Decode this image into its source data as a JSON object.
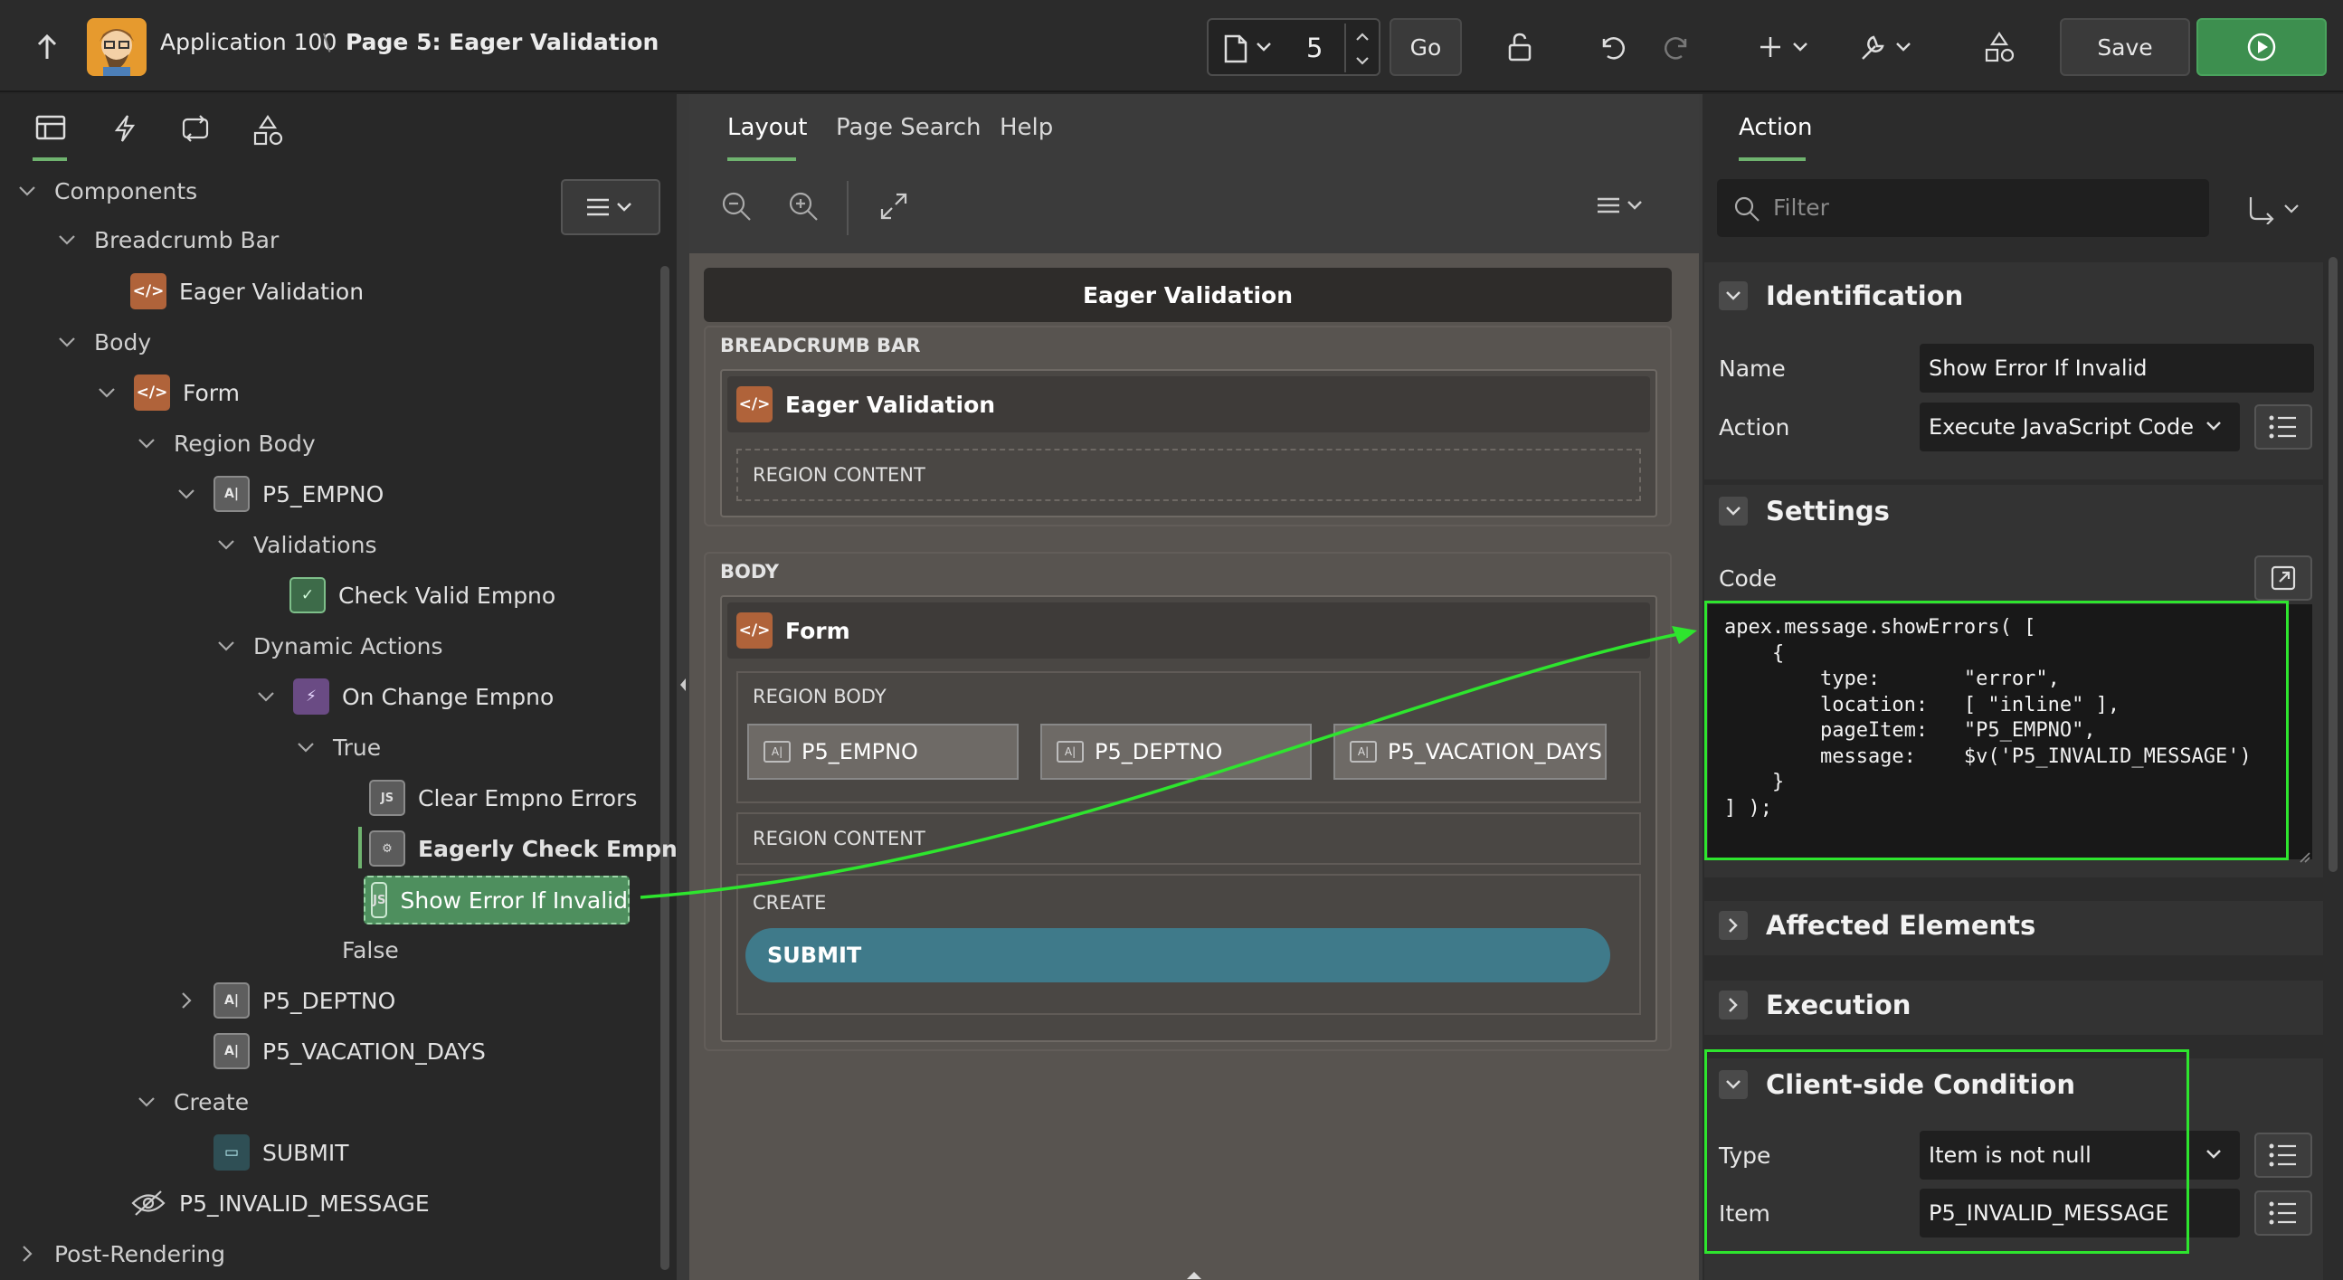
{
  "header": {
    "app_title": "Application 100",
    "separator": "\\",
    "page_title": "Page 5: Eager Validation",
    "page_number": "5",
    "go_label": "Go",
    "save_label": "Save"
  },
  "left_tabs": [
    "rendering-icon",
    "dynamic-actions-icon",
    "processing-icon",
    "shared-components-icon"
  ],
  "tree": {
    "components": "Components",
    "breadcrumb_bar": "Breadcrumb Bar",
    "eager_validation": "Eager Validation",
    "body": "Body",
    "form": "Form",
    "region_body": "Region Body",
    "p5_empno": "P5_EMPNO",
    "validations": "Validations",
    "check_valid_empno": "Check Valid Empno",
    "dynamic_actions": "Dynamic Actions",
    "on_change_empno": "On Change Empno",
    "true_label": "True",
    "clear_empno_errors": "Clear Empno Errors",
    "eagerly_check_empno": "Eagerly Check Empno",
    "show_error_if_invalid": "Show Error If Invalid",
    "false_label": "False",
    "p5_deptno": "P5_DEPTNO",
    "p5_vacation_days": "P5_VACATION_DAYS",
    "create": "Create",
    "submit": "SUBMIT",
    "p5_invalid_message": "P5_INVALID_MESSAGE",
    "post_rendering": "Post-Rendering"
  },
  "center": {
    "tabs": [
      "Layout",
      "Page Search",
      "Help"
    ],
    "active_tab": "Layout",
    "page_header": "Eager Validation",
    "breadcrumb_bar": "BREADCRUMB BAR",
    "breadcrumb_region": "Eager Validation",
    "region_content_1": "REGION CONTENT",
    "body": "BODY",
    "form_region": "Form",
    "region_body": "REGION BODY",
    "items": [
      "P5_EMPNO",
      "P5_DEPTNO",
      "P5_VACATION_DAYS"
    ],
    "region_content_2": "REGION CONTENT",
    "create": "CREATE",
    "submit_button": "SUBMIT"
  },
  "right": {
    "tab": "Action",
    "filter_placeholder": "Filter",
    "identification": {
      "title": "Identification",
      "name_label": "Name",
      "name_value": "Show Error If Invalid",
      "action_label": "Action",
      "action_value": "Execute JavaScript Code"
    },
    "settings": {
      "title": "Settings",
      "code_label": "Code",
      "code": "apex.message.showErrors( [\n    {\n        type:       \"error\",\n        location:   [ \"inline\" ],\n        pageItem:   \"P5_EMPNO\",\n        message:    $v('P5_INVALID_MESSAGE')\n    }\n] );"
    },
    "affected_elements": "Affected Elements",
    "execution": "Execution",
    "client_side_condition": {
      "title": "Client-side Condition",
      "type_label": "Type",
      "type_value": "Item is not null",
      "item_label": "Item",
      "item_value": "P5_INVALID_MESSAGE"
    }
  },
  "colors": {
    "highlight": "#2ee52e",
    "run_button": "#3d8f4f",
    "submit_button": "#3f7a8a",
    "region_icon": "#b0633a",
    "selected_node": "#4e8f5e"
  }
}
